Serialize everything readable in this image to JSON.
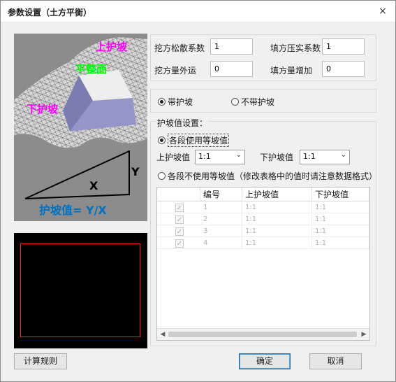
{
  "window": {
    "title": "参数设置（土方平衡）",
    "close_icon": "×"
  },
  "illustration": {
    "upper_slope": "上护坡",
    "flat": "平整面",
    "lower_slope": "下护坡",
    "y": "Y",
    "x": "X",
    "formula": "护坡值= Y/X"
  },
  "coefficients": {
    "cut_loose_label": "挖方松散系数",
    "cut_loose_value": "1",
    "fill_compact_label": "填方压实系数",
    "fill_compact_value": "1",
    "cut_export_label": "挖方量外运",
    "cut_export_value": "0",
    "fill_add_label": "填方量增加",
    "fill_add_value": "0"
  },
  "slope_mode": {
    "with_slope": "带护坡",
    "without_slope": "不带护坡"
  },
  "slope_settings": {
    "group_title": "护坡值设置：",
    "equal_option": "各段使用等坡值",
    "upper_label": "上护坡值",
    "upper_value": "1:1",
    "lower_label": "下护坡值",
    "lower_value": "1:1",
    "unequal_option": "各段不使用等坡值（修改表格中的值时请注意数据格式）"
  },
  "table": {
    "headers": [
      "",
      "编号",
      "上护坡值",
      "下护坡值"
    ],
    "rows": [
      {
        "checked": "✓",
        "id": "1",
        "upper": "1:1",
        "lower": "1:1"
      },
      {
        "checked": "✓",
        "id": "2",
        "upper": "1:1",
        "lower": "1:1"
      },
      {
        "checked": "✓",
        "id": "3",
        "upper": "1:1",
        "lower": "1:1"
      },
      {
        "checked": "✓",
        "id": "4",
        "upper": "1:1",
        "lower": "1:1"
      }
    ],
    "scroll_left": "◀",
    "scroll_right": "▶"
  },
  "buttons": {
    "rules": "计算规则",
    "ok": "确定",
    "cancel": "取消"
  }
}
